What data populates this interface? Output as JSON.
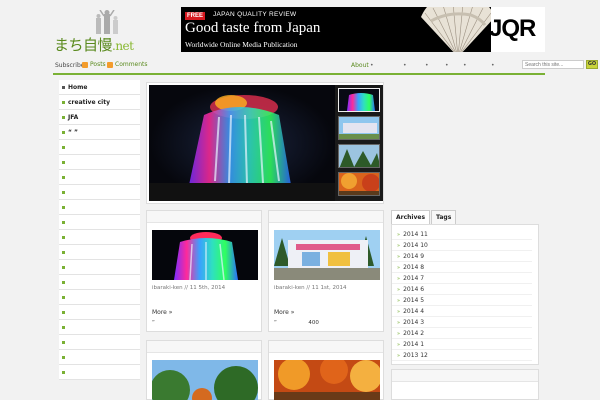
{
  "site": {
    "logo_text": "まち自慢",
    "logo_suffix": ".net"
  },
  "ad": {
    "badge": "FREE",
    "subtitle": "JAPAN QUALITY REVIEW",
    "headline": "Good taste from Japan",
    "tagline": "Worldwide Online Media Publication",
    "brand": "JQR"
  },
  "navbar": {
    "subscribe_label": "Subscribe:",
    "posts_label": "Posts",
    "comments_label": "Comments",
    "about_label": "About",
    "search_placeholder": "Search this site...",
    "go_label": "GO"
  },
  "sidebar": {
    "items": [
      {
        "label": "Home"
      },
      {
        "label": "creative city"
      },
      {
        "label": "JFA"
      },
      {
        "label": "“ ”"
      },
      {
        "label": ""
      },
      {
        "label": ""
      },
      {
        "label": ""
      },
      {
        "label": ""
      },
      {
        "label": ""
      },
      {
        "label": ""
      },
      {
        "label": ""
      },
      {
        "label": ""
      },
      {
        "label": ""
      },
      {
        "label": ""
      },
      {
        "label": ""
      },
      {
        "label": ""
      },
      {
        "label": ""
      },
      {
        "label": ""
      },
      {
        "label": ""
      },
      {
        "label": ""
      }
    ]
  },
  "posts": [
    {
      "meta": "ibaraki-ken // 11  5th, 2014",
      "more": "More »",
      "excerpt": "“"
    },
    {
      "meta": "ibaraki-ken // 11  1st, 2014",
      "more": "More »",
      "excerpt": "“                  400"
    }
  ],
  "widget": {
    "tabs": [
      "Archives",
      "Tags"
    ],
    "archives": [
      "2014 11",
      "2014 10",
      "2014 9",
      "2014 8",
      "2014 7",
      "2014 6",
      "2014 5",
      "2014 4",
      "2014 3",
      "2014 2",
      "2014 1",
      "2013 12"
    ]
  },
  "colors": {
    "accent": "#7ab135",
    "link": "#5a8a1e",
    "rss": "#f39c2c"
  }
}
